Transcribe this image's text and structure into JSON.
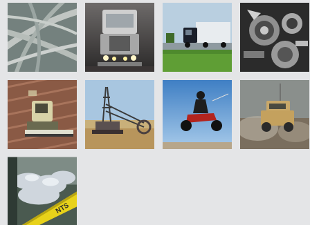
{
  "gallery": {
    "tiles": [
      {
        "icon": "highway-interchange-icon"
      },
      {
        "icon": "semi-truck-front-icon"
      },
      {
        "icon": "semi-truck-highway-icon"
      },
      {
        "icon": "engine-parts-icon"
      },
      {
        "icon": "tractor-field-icon"
      },
      {
        "icon": "bucket-wheel-excavator-icon"
      },
      {
        "icon": "atv-jump-icon"
      },
      {
        "icon": "military-vehicle-icon"
      },
      {
        "icon": "salt-storage-icon"
      }
    ],
    "sign_label": "NTS"
  },
  "colors": {
    "background": "#e4e5e7",
    "sign_yellow": "#e8d21a"
  }
}
